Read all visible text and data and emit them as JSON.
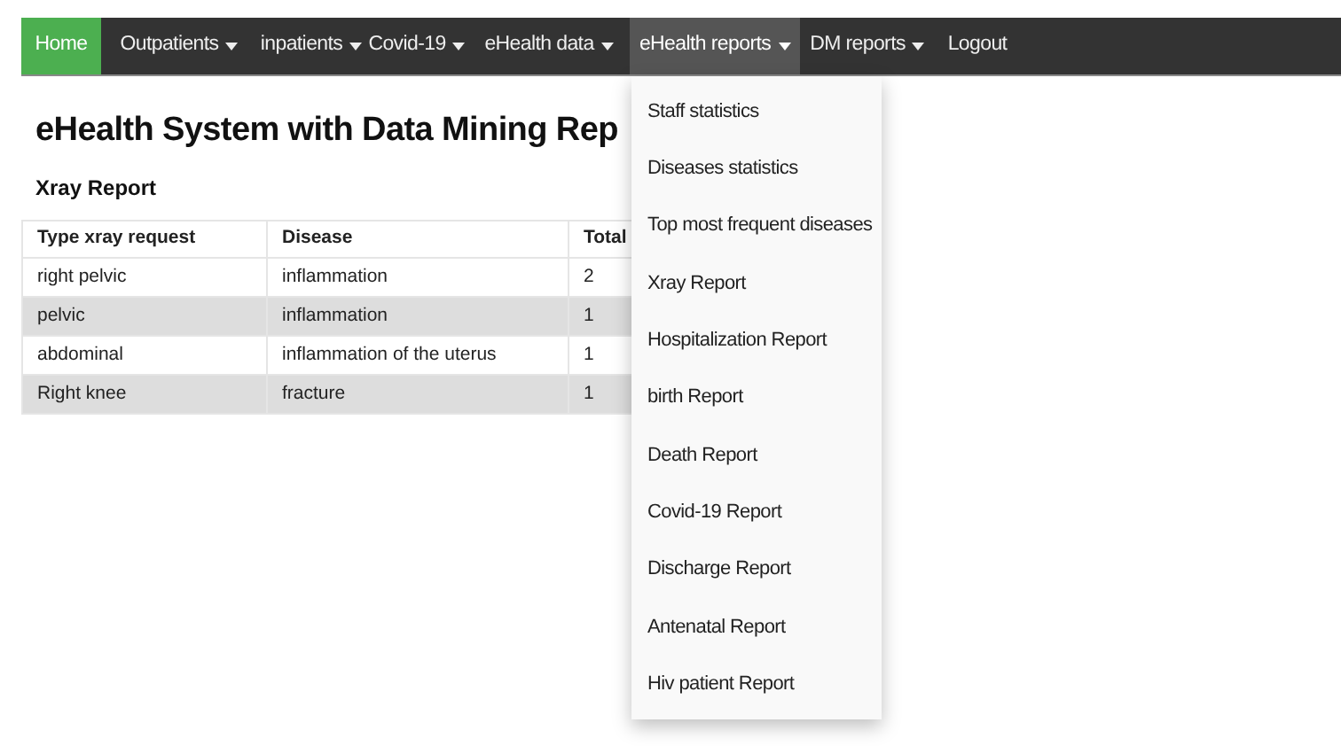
{
  "navbar": {
    "items": [
      {
        "label": "Home",
        "selected": true,
        "dropdown": false
      },
      {
        "label": "Outpatients",
        "selected": false,
        "dropdown": true
      },
      {
        "label": "inpatients",
        "selected": false,
        "dropdown": true
      },
      {
        "label": "Covid-19",
        "selected": false,
        "dropdown": true
      },
      {
        "label": "eHealth data",
        "selected": false,
        "dropdown": true
      },
      {
        "label": "eHealth reports",
        "selected": false,
        "dropdown": true,
        "expanded": true
      },
      {
        "label": "DM reports",
        "selected": false,
        "dropdown": true
      },
      {
        "label": "Logout",
        "selected": false,
        "dropdown": false
      }
    ]
  },
  "page_title": "eHealth System with Data Mining Rep",
  "report_title": "Xray Report",
  "table": {
    "columns": [
      "Type xray request",
      "Disease",
      "Total"
    ],
    "rows": [
      [
        "right pelvic",
        "inflammation",
        "2"
      ],
      [
        "pelvic",
        "inflammation",
        "1"
      ],
      [
        "abdominal",
        "inflammation of the uterus",
        "1"
      ],
      [
        "Right knee",
        "fracture",
        "1"
      ]
    ]
  },
  "dropdown_menu": {
    "items": [
      "Staff statistics",
      "Diseases statistics",
      "Top most frequent diseases",
      "Xray Report",
      "Hospitalization Report",
      "birth Report",
      "Death Report",
      "Covid-19 Report",
      "Discharge Report",
      "Antenatal Report",
      "Hiv patient Report"
    ]
  }
}
